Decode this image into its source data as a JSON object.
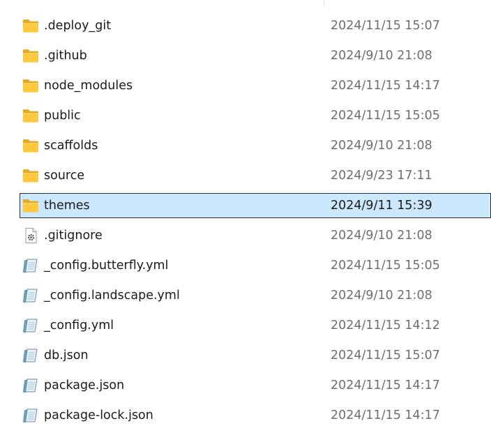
{
  "files": [
    {
      "name": ".deploy_git",
      "date": "2024/11/15 15:07",
      "icon": "folder-icon",
      "selected": false
    },
    {
      "name": ".github",
      "date": "2024/9/10 21:08",
      "icon": "folder-icon",
      "selected": false
    },
    {
      "name": "node_modules",
      "date": "2024/11/15 14:17",
      "icon": "folder-icon",
      "selected": false
    },
    {
      "name": "public",
      "date": "2024/11/15 15:05",
      "icon": "folder-icon",
      "selected": false
    },
    {
      "name": "scaffolds",
      "date": "2024/9/10 21:08",
      "icon": "folder-icon",
      "selected": false
    },
    {
      "name": "source",
      "date": "2024/9/23 17:11",
      "icon": "folder-icon",
      "selected": false
    },
    {
      "name": "themes",
      "date": "2024/9/11 15:39",
      "icon": "folder-icon",
      "selected": true
    },
    {
      "name": ".gitignore",
      "date": "2024/9/10 21:08",
      "icon": "settings-file-icon",
      "selected": false
    },
    {
      "name": "_config.butterfly.yml",
      "date": "2024/11/15 15:05",
      "icon": "text-file-icon",
      "selected": false
    },
    {
      "name": "_config.landscape.yml",
      "date": "2024/9/10 21:08",
      "icon": "text-file-icon",
      "selected": false
    },
    {
      "name": "_config.yml",
      "date": "2024/11/15 14:12",
      "icon": "text-file-icon",
      "selected": false
    },
    {
      "name": "db.json",
      "date": "2024/11/15 15:07",
      "icon": "text-file-icon",
      "selected": false
    },
    {
      "name": "package.json",
      "date": "2024/11/15 14:17",
      "icon": "text-file-icon",
      "selected": false
    },
    {
      "name": "package-lock.json",
      "date": "2024/11/15 14:17",
      "icon": "text-file-icon",
      "selected": false
    }
  ],
  "colors": {
    "selection_bg": "#cce8ff",
    "selection_border": "#2b2b2b",
    "folder": "#ffc83d",
    "date_text": "#6e6e6e"
  }
}
